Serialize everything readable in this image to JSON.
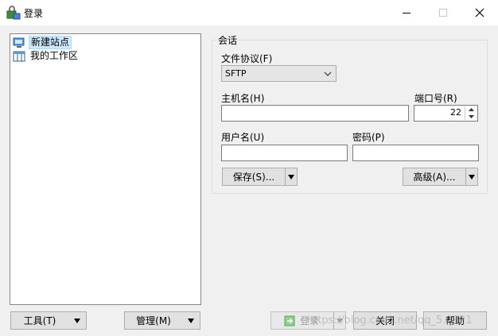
{
  "window": {
    "title": "登录",
    "minimize_icon": "minimize-icon",
    "maximize_icon": "maximize-icon",
    "close_icon": "close-icon"
  },
  "site_tree": {
    "items": [
      {
        "label": "新建站点",
        "icon": "new-site-icon",
        "selected": true
      },
      {
        "label": "我的工作区",
        "icon": "workspace-icon",
        "selected": false
      }
    ]
  },
  "session": {
    "group_label": "会话",
    "protocol": {
      "label": "文件协议(F)",
      "value": "SFTP"
    },
    "host": {
      "label": "主机名(H)",
      "value": ""
    },
    "port": {
      "label": "端口号(R)",
      "value": "22"
    },
    "user": {
      "label": "用户名(U)",
      "value": ""
    },
    "password": {
      "label": "密码(P)",
      "value": ""
    },
    "save_button": "保存(S)...",
    "advanced_button": "高级(A)..."
  },
  "footer": {
    "tools_button": "工具(T)",
    "manage_button": "管理(M)",
    "login_button": "登录",
    "close_button": "关闭",
    "help_button": "帮助"
  },
  "watermark": "https://blog.csdn.net/qq_5...321"
}
